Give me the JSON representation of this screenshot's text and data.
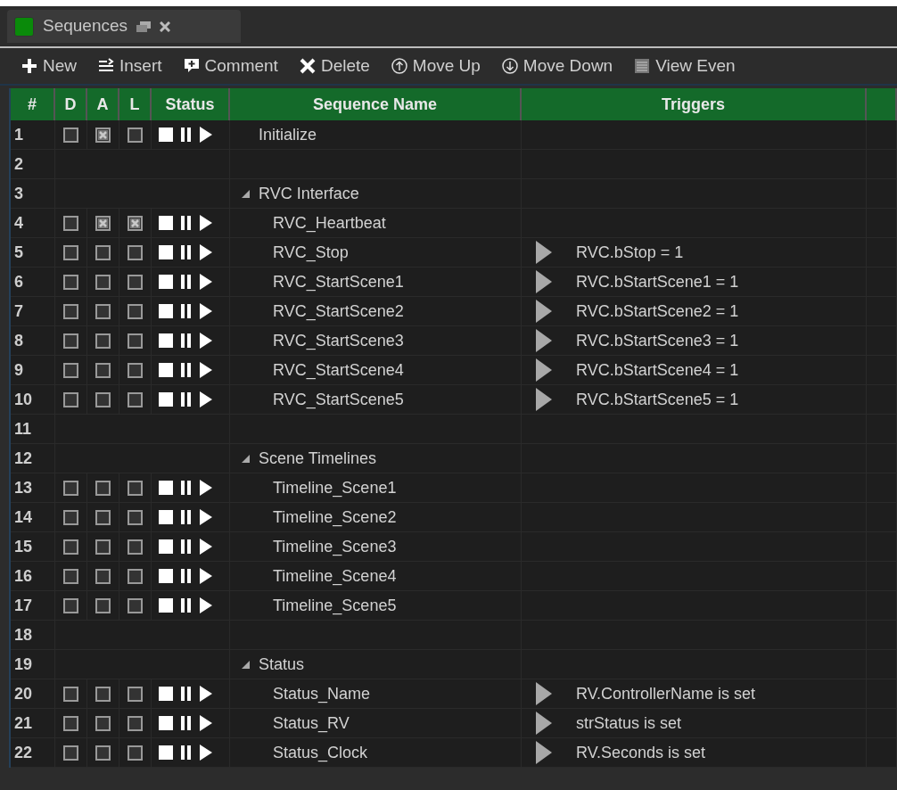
{
  "tab": {
    "title": "Sequences",
    "selected": true
  },
  "toolbar": [
    {
      "kind": "plus",
      "label": "New"
    },
    {
      "kind": "insert",
      "label": "Insert"
    },
    {
      "kind": "comment",
      "label": "Comment"
    },
    {
      "kind": "cross",
      "label": "Delete"
    },
    {
      "kind": "up",
      "label": "Move Up"
    },
    {
      "kind": "down",
      "label": "Move Down"
    },
    {
      "kind": "list",
      "label": "View Even"
    }
  ],
  "table": {
    "columns": [
      "#",
      "D",
      "A",
      "L",
      "Status",
      "Sequence Name",
      "Triggers"
    ],
    "rows": [
      {
        "number": "1",
        "kind": "sequence",
        "d": false,
        "a": true,
        "l": false,
        "name": "Initialize"
      },
      {
        "number": "2",
        "kind": "blank"
      },
      {
        "number": "3",
        "kind": "group",
        "expanded": true,
        "name": "RVC Interface",
        "children": [
          {
            "number": "4",
            "kind": "sequence",
            "d": false,
            "a": true,
            "l": true,
            "name": "RVC_Heartbeat"
          },
          {
            "number": "5",
            "kind": "sequence",
            "d": false,
            "a": false,
            "l": false,
            "name": "RVC_Stop",
            "trigger": "RVC.bStop = 1"
          },
          {
            "number": "6",
            "kind": "sequence",
            "d": false,
            "a": false,
            "l": false,
            "name": "RVC_StartScene1",
            "trigger": "RVC.bStartScene1 = 1"
          },
          {
            "number": "7",
            "kind": "sequence",
            "d": false,
            "a": false,
            "l": false,
            "name": "RVC_StartScene2",
            "trigger": "RVC.bStartScene2 = 1"
          },
          {
            "number": "8",
            "kind": "sequence",
            "d": false,
            "a": false,
            "l": false,
            "name": "RVC_StartScene3",
            "trigger": "RVC.bStartScene3 = 1"
          },
          {
            "number": "9",
            "kind": "sequence",
            "d": false,
            "a": false,
            "l": false,
            "name": "RVC_StartScene4",
            "trigger": "RVC.bStartScene4 = 1"
          },
          {
            "number": "10",
            "kind": "sequence",
            "d": false,
            "a": false,
            "l": false,
            "name": "RVC_StartScene5",
            "trigger": "RVC.bStartScene5 = 1"
          }
        ]
      },
      {
        "number": "11",
        "kind": "blank"
      },
      {
        "number": "12",
        "kind": "group",
        "expanded": true,
        "name": "Scene Timelines",
        "children": [
          {
            "number": "13",
            "kind": "sequence",
            "d": false,
            "a": false,
            "l": false,
            "name": "Timeline_Scene1"
          },
          {
            "number": "14",
            "kind": "sequence",
            "d": false,
            "a": false,
            "l": false,
            "name": "Timeline_Scene2"
          },
          {
            "number": "15",
            "kind": "sequence",
            "d": false,
            "a": false,
            "l": false,
            "name": "Timeline_Scene3"
          },
          {
            "number": "16",
            "kind": "sequence",
            "d": false,
            "a": false,
            "l": false,
            "name": "Timeline_Scene4"
          },
          {
            "number": "17",
            "kind": "sequence",
            "d": false,
            "a": false,
            "l": false,
            "name": "Timeline_Scene5"
          }
        ]
      },
      {
        "number": "18",
        "kind": "blank"
      },
      {
        "number": "19",
        "kind": "group",
        "expanded": true,
        "name": "Status",
        "children": [
          {
            "number": "20",
            "kind": "sequence",
            "d": false,
            "a": false,
            "l": false,
            "name": "Status_Name",
            "trigger": "RV.ControllerName is set"
          },
          {
            "number": "21",
            "kind": "sequence",
            "d": false,
            "a": false,
            "l": false,
            "name": "Status_RV",
            "trigger": "strStatus is set"
          },
          {
            "number": "22",
            "kind": "sequence",
            "d": false,
            "a": false,
            "l": false,
            "name": "Status_Clock",
            "trigger": "RV.Seconds is set"
          }
        ]
      }
    ]
  }
}
